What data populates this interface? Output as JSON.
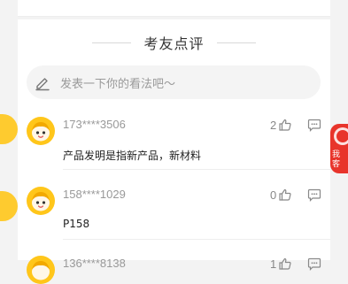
{
  "section": {
    "title": "考友点评"
  },
  "input": {
    "placeholder": "发表一下你的看法吧～"
  },
  "comments": [
    {
      "user": "173****3506",
      "likes": "2",
      "text": "产品发明是指新产品，新材料"
    },
    {
      "user": "158****1029",
      "likes": "0",
      "text": "P158"
    },
    {
      "user": "136****8138",
      "likes": "1",
      "text": ""
    }
  ],
  "promo": {
    "text_line1": "我",
    "text_line2": "客"
  },
  "colors": {
    "avatar": "#ffc61a",
    "promo": "#e8342b",
    "background": "#f3f3f3",
    "card": "#ffffff"
  },
  "icons": [
    "pencil-icon",
    "thumbs-up-icon",
    "comment-bubble-icon",
    "avatar-face-icon"
  ]
}
